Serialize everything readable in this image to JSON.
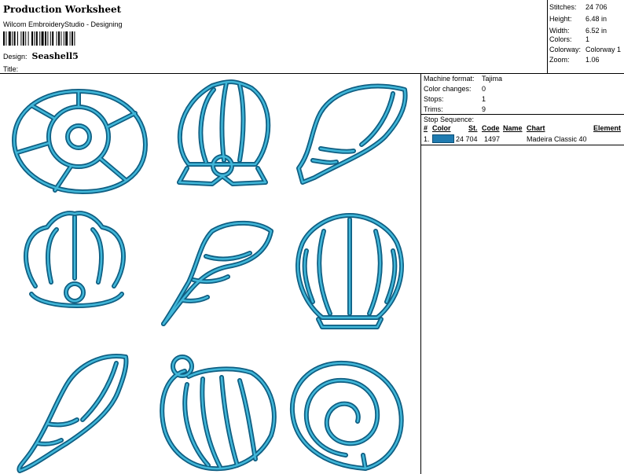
{
  "header": {
    "title": "Production Worksheet",
    "subtitle": "Wilcom EmbroideryStudio - Designing",
    "design_label": "Design:",
    "design_value": "Seashell5",
    "title_label": "Title:"
  },
  "stats": [
    {
      "label": "Stitches:",
      "value": "24 706"
    },
    {
      "label": "Height:",
      "value": "6.48 in"
    },
    {
      "label": "Width:",
      "value": "6.52 in"
    },
    {
      "label": "Colors:",
      "value": "1"
    },
    {
      "label": "Colorway:",
      "value": "Colorway 1"
    },
    {
      "label": "Zoom:",
      "value": "1.06"
    }
  ],
  "machine_info": [
    {
      "label": "Machine format:",
      "value": "Tajima"
    },
    {
      "label": "Color changes:",
      "value": "0"
    },
    {
      "label": "Stops:",
      "value": "1"
    },
    {
      "label": "Trims:",
      "value": "9"
    }
  ],
  "stop_sequence": {
    "title": "Stop Sequence:",
    "headers": {
      "num": "#",
      "color": "Color",
      "stitches": "St.",
      "code": "Code",
      "name": "Name",
      "chart": "Chart",
      "element": "Element"
    },
    "rows": [
      {
        "num": "1.",
        "color": "#1f7bb0",
        "stitches": "24 704",
        "code": "1497",
        "name": "",
        "chart": "Madeira Classic 40",
        "element": ""
      }
    ]
  },
  "colors": {
    "thread_outline": "#0e5e82",
    "thread_fill": "#41b7d9"
  }
}
